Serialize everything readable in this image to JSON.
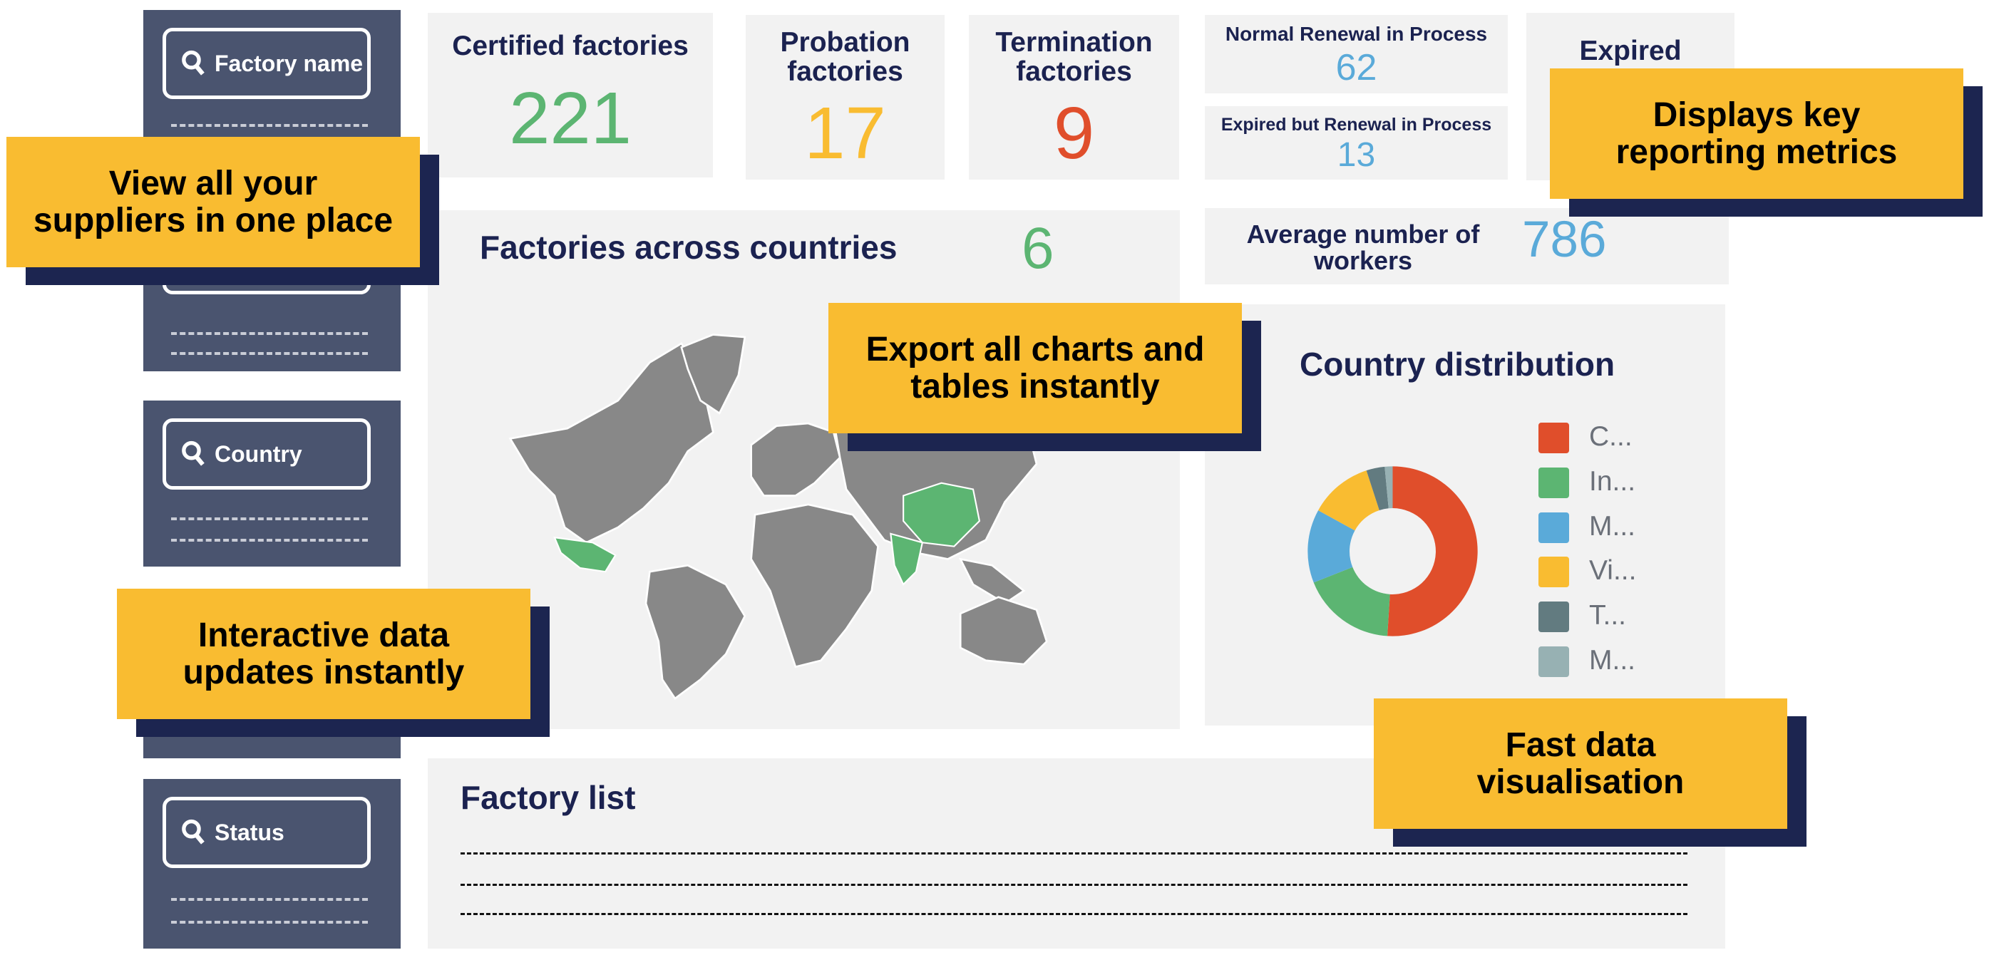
{
  "filters": [
    {
      "label": "Factory name",
      "icon": "search-icon"
    },
    {
      "label": "Country",
      "icon": "search-icon"
    },
    {
      "label": "Status",
      "icon": "search-icon"
    }
  ],
  "metrics": {
    "certified": {
      "label": "Certified factories",
      "value": "221",
      "color": "#5cb572"
    },
    "probation": {
      "label": "Probation factories",
      "value": "17",
      "color": "#f9bc31"
    },
    "termination": {
      "label": "Termination factories",
      "value": "9",
      "color": "#e04e2b"
    },
    "normal_renewal": {
      "label": "Normal Renewal in Process",
      "value": "62",
      "color": "#5aaad9"
    },
    "expired_renewal": {
      "label": "Expired but Renewal in Process",
      "value": "13",
      "color": "#5aaad9"
    },
    "expired": {
      "label": "Expired"
    },
    "countries": {
      "label": "Factories across countries",
      "value": "6",
      "color": "#5cb572"
    },
    "avg_workers": {
      "label": "Average number of workers",
      "value": "786",
      "color": "#5aaad9"
    }
  },
  "map": {
    "highlighted": [
      "Mexico",
      "India",
      "China"
    ],
    "highlight_color": "#5cb572",
    "base_color": "#888888"
  },
  "country_distribution": {
    "title": "Country distribution",
    "chart_data": {
      "type": "pie",
      "donut": true,
      "categories": [
        "C...",
        "In...",
        "M...",
        "Vi...",
        "T...",
        "M..."
      ],
      "values": [
        51,
        18,
        14,
        12,
        3.5,
        1.5
      ],
      "colors": [
        "#e04e2b",
        "#5cb572",
        "#5aaad9",
        "#f9bc31",
        "#627b80",
        "#97b1b3"
      ]
    }
  },
  "factory_list": {
    "title": "Factory list"
  },
  "callouts": [
    "View all your suppliers in one place",
    "Export all charts and tables instantly",
    "Displays key reporting metrics",
    "Interactive data updates instantly",
    "Fast data visualisation"
  ]
}
